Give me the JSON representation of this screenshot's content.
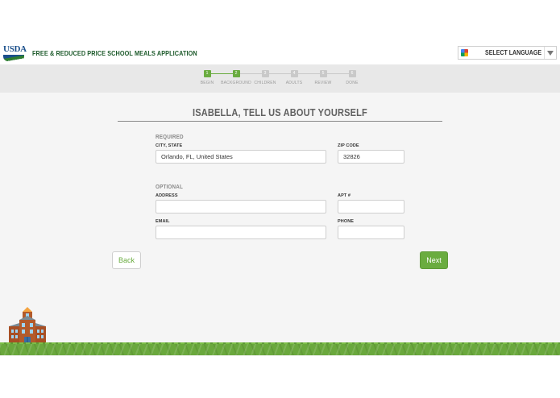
{
  "header": {
    "logo_text": "USDA",
    "app_title": "FREE & REDUCED PRICE SCHOOL MEALS APPLICATION",
    "language_select": "SELECT LANGUAGE"
  },
  "progress": {
    "steps": [
      {
        "number": "1",
        "label": "BEGIN",
        "status": "done"
      },
      {
        "number": "2",
        "label": "BACKGROUND",
        "status": "current"
      },
      {
        "number": "3",
        "label": "CHILDREN",
        "status": "todo"
      },
      {
        "number": "4",
        "label": "ADULTS",
        "status": "todo"
      },
      {
        "number": "5",
        "label": "REVIEW",
        "status": "todo"
      },
      {
        "number": "6",
        "label": "DONE",
        "status": "todo"
      }
    ]
  },
  "main": {
    "heading": "ISABELLA, TELL US ABOUT YOURSELF",
    "required": {
      "title": "REQUIRED",
      "city_label": "CITY, STATE",
      "city_value": "Orlando, FL, United States",
      "zip_label": "ZIP CODE",
      "zip_value": "32826"
    },
    "optional": {
      "title": "OPTIONAL",
      "address_label": "ADDRESS",
      "address_value": "",
      "apt_label": "APT #",
      "apt_value": "",
      "email_label": "EMAIL",
      "email_value": "",
      "phone_label": "PHONE",
      "phone_value": ""
    },
    "back_label": "Back",
    "next_label": "Next"
  },
  "colors": {
    "accent_green": "#6aac40",
    "title_green": "#1e5b2c",
    "usda_blue": "#1a4f8b",
    "background": "#f5f5f5"
  }
}
